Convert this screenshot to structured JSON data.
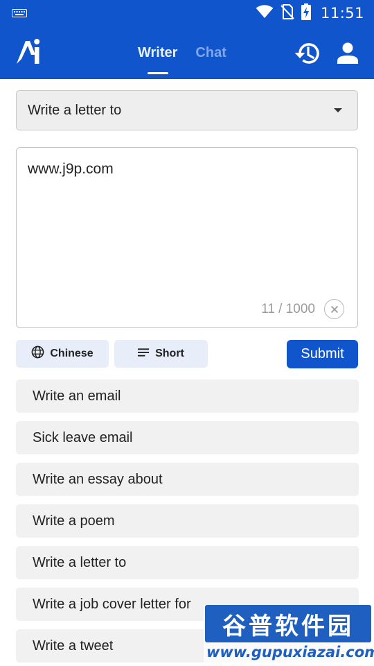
{
  "status_bar": {
    "time": "11:51",
    "icons": [
      "keyboard-icon",
      "wifi-icon",
      "no-sim-icon",
      "battery-charging-icon"
    ]
  },
  "app_bar": {
    "tabs": [
      {
        "label": "Writer",
        "active": true
      },
      {
        "label": "Chat",
        "active": false
      }
    ],
    "actions": [
      "history-icon",
      "account-icon"
    ],
    "color": "#1155cc"
  },
  "template_select": {
    "selected": "Write a letter to"
  },
  "editor": {
    "value": "www.j9p.com",
    "counter": "11 / 1000"
  },
  "options": {
    "language": "Chinese",
    "length": "Short",
    "submit_label": "Submit"
  },
  "suggestions": [
    "Write an email",
    "Sick leave email",
    "Write an essay about",
    "Write a poem",
    "Write a letter to",
    "Write a job cover letter for",
    "Write a tweet"
  ],
  "watermark": {
    "brand": "谷普软件园",
    "url": "www.gupuxiazai.com"
  }
}
